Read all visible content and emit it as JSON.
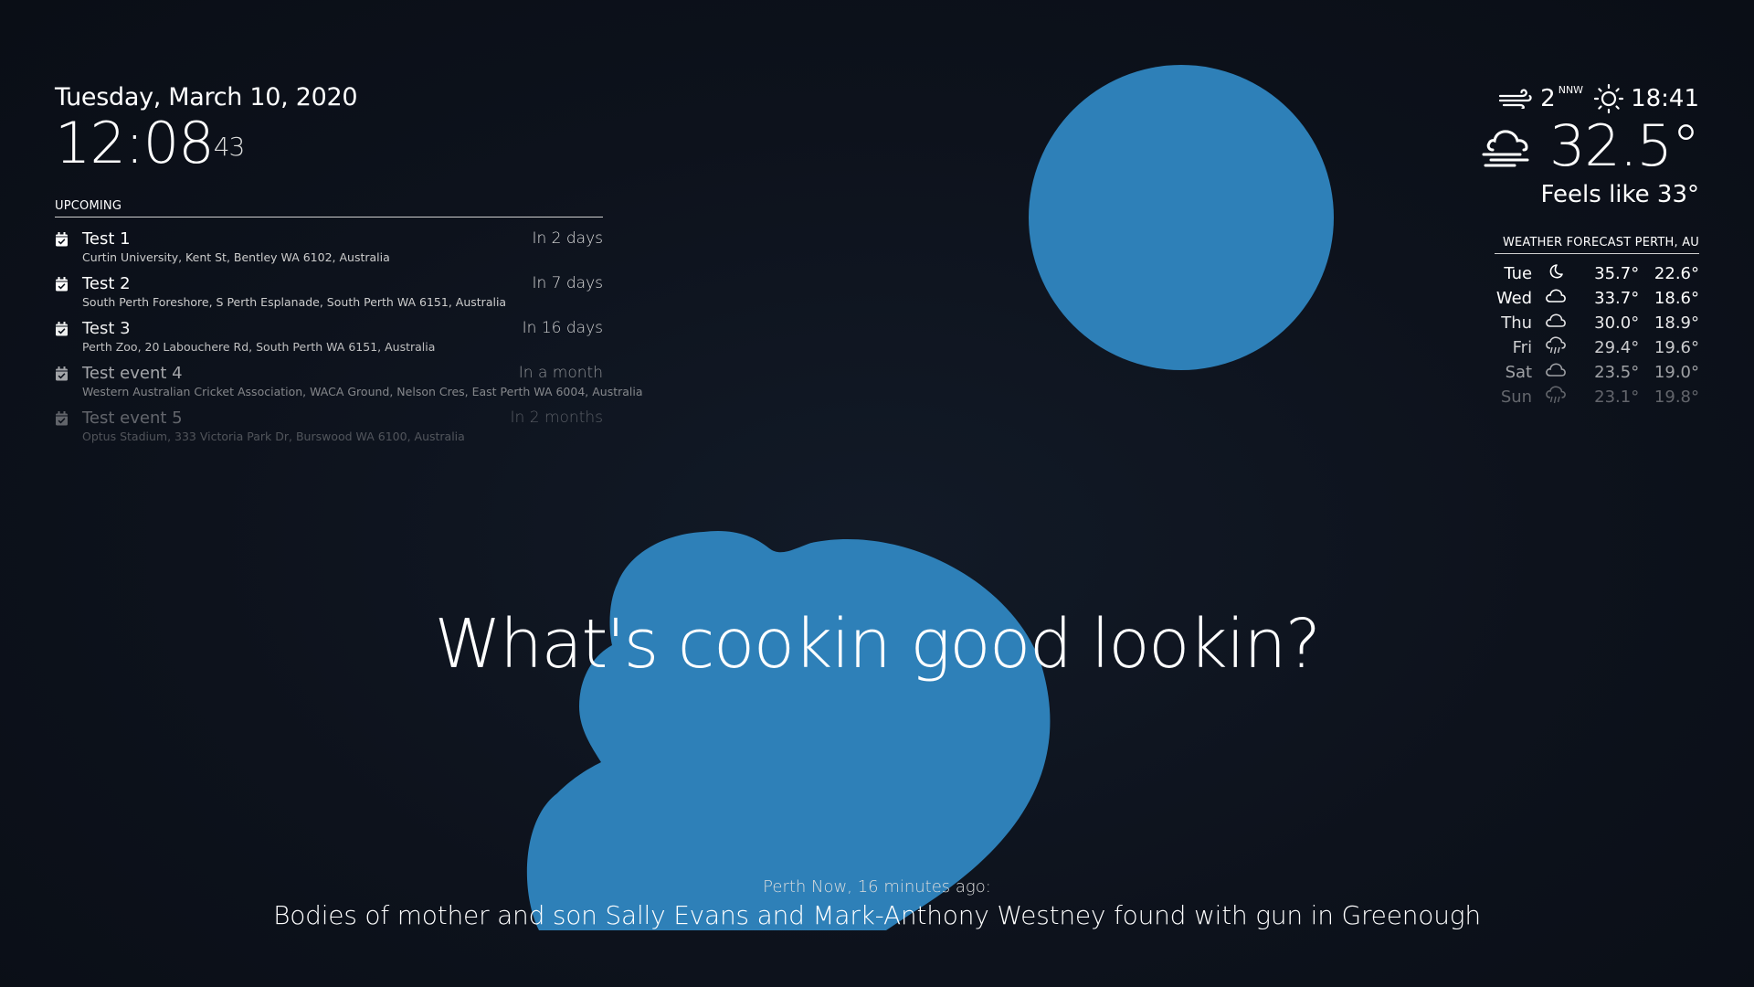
{
  "theme": {
    "blob_color": "#2e80b8",
    "background": "#0d121c"
  },
  "clock": {
    "date": "Tuesday, March 10, 2020",
    "time": "12:08",
    "seconds": "43"
  },
  "calendar": {
    "header": "UPCOMING",
    "events": [
      {
        "title": "Test 1",
        "when": "In 2 days",
        "location": "Curtin University, Kent St, Bentley WA 6102, Australia",
        "icon": "calendar-check-icon"
      },
      {
        "title": "Test 2",
        "when": "In 7 days",
        "location": "South Perth Foreshore, S Perth Esplanade, South Perth WA 6151, Australia",
        "icon": "calendar-check-icon"
      },
      {
        "title": "Test 3",
        "when": "In 16 days",
        "location": "Perth Zoo, 20 Labouchere Rd, South Perth WA 6151, Australia",
        "icon": "calendar-check-icon"
      },
      {
        "title": "Test event 4",
        "when": "In a month",
        "location": "Western Australian Cricket Association, WACA Ground, Nelson Cres, East Perth WA 6004, Australia",
        "icon": "calendar-check-icon"
      },
      {
        "title": "Test event 5",
        "when": "In 2 months",
        "location": "Optus Stadium, 333 Victoria Park Dr, Burswood WA 6100, Australia",
        "icon": "calendar-check-icon"
      }
    ]
  },
  "weather_current": {
    "wind_speed": "2",
    "wind_direction": "NNW",
    "sun_time": "18:41",
    "temperature": "32.5°",
    "feels_like": "Feels like 33°",
    "wind_icon": "wind-icon",
    "sun_icon": "sunset-icon",
    "condition_icon": "windy-cloud-icon"
  },
  "weather_forecast": {
    "header": "WEATHER FORECAST PERTH, AU",
    "days": [
      {
        "day": "Tue",
        "icon": "moon-icon",
        "max": "35.7°",
        "min": "22.6°"
      },
      {
        "day": "Wed",
        "icon": "cloud-icon",
        "max": "33.7°",
        "min": "18.6°"
      },
      {
        "day": "Thu",
        "icon": "cloud-icon",
        "max": "30.0°",
        "min": "18.9°"
      },
      {
        "day": "Fri",
        "icon": "rain-cloud-icon",
        "max": "29.4°",
        "min": "19.6°"
      },
      {
        "day": "Sat",
        "icon": "cloud-icon",
        "max": "23.5°",
        "min": "19.0°"
      },
      {
        "day": "Sun",
        "icon": "rain-cloud-icon",
        "max": "23.1°",
        "min": "19.8°"
      }
    ]
  },
  "compliment": {
    "text": "What's cookin good lookin?"
  },
  "news": {
    "source": "Perth Now, 16 minutes ago:",
    "headline": "Bodies of mother and son Sally Evans and Mark-Anthony Westney found with gun in Greenough"
  }
}
